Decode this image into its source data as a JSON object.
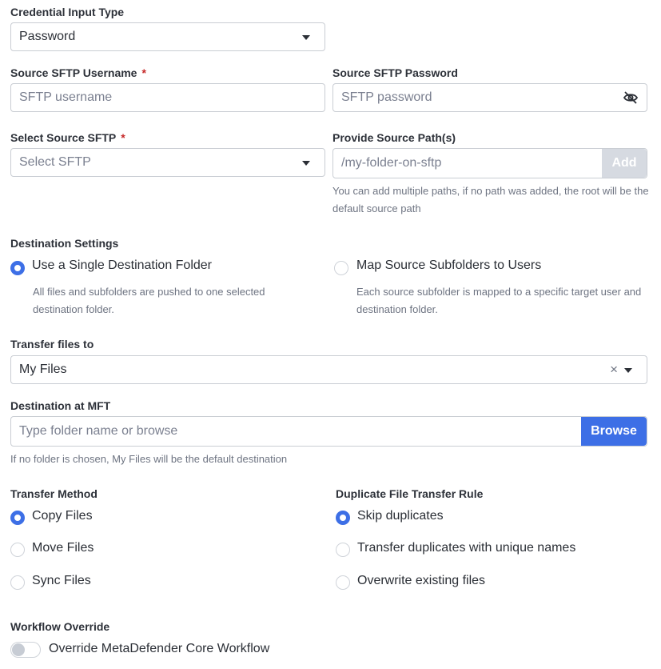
{
  "credential_type": {
    "label": "Credential Input Type",
    "value": "Password"
  },
  "username": {
    "label": "Source SFTP Username",
    "required": "*",
    "placeholder": "SFTP username"
  },
  "password": {
    "label": "Source SFTP Password",
    "placeholder": "SFTP password",
    "icon": "eye-slash-icon"
  },
  "sftp_select": {
    "label": "Select Source SFTP",
    "required": "*",
    "placeholder": "Select SFTP"
  },
  "source_path": {
    "label": "Provide Source Path(s)",
    "placeholder": "/my-folder-on-sftp",
    "add_label": "Add",
    "help": "You can add multiple paths, if no path was added, the root will be the default source path"
  },
  "destination_settings": {
    "label": "Destination Settings",
    "options": [
      {
        "label": "Use a Single Destination Folder",
        "description": "All files and subfolders are pushed to one selected destination folder.",
        "selected": true
      },
      {
        "label": "Map Source Subfolders to Users",
        "description": "Each source subfolder is mapped to a specific target user and destination folder.",
        "selected": false
      }
    ]
  },
  "transfer_to": {
    "label": "Transfer files to",
    "value": "My Files",
    "clear": "×"
  },
  "destination_mft": {
    "label": "Destination at MFT",
    "placeholder": "Type folder name or browse",
    "browse_label": "Browse",
    "help": "If no folder is chosen, My Files will be the default destination"
  },
  "transfer_method": {
    "label": "Transfer Method",
    "options": [
      {
        "label": "Copy Files",
        "selected": true
      },
      {
        "label": "Move Files",
        "selected": false
      },
      {
        "label": "Sync Files",
        "selected": false
      }
    ]
  },
  "duplicate_rule": {
    "label": "Duplicate File Transfer Rule",
    "options": [
      {
        "label": "Skip duplicates",
        "selected": true
      },
      {
        "label": "Transfer duplicates with unique names",
        "selected": false
      },
      {
        "label": "Overwrite existing files",
        "selected": false
      }
    ]
  },
  "workflow_override": {
    "label": "Workflow Override",
    "toggle_label": "Override MetaDefender Core Workflow",
    "enabled": false
  },
  "colors": {
    "accent": "#3d6fe6",
    "required": "#c62828",
    "disabled_button": "#d6dae1"
  }
}
